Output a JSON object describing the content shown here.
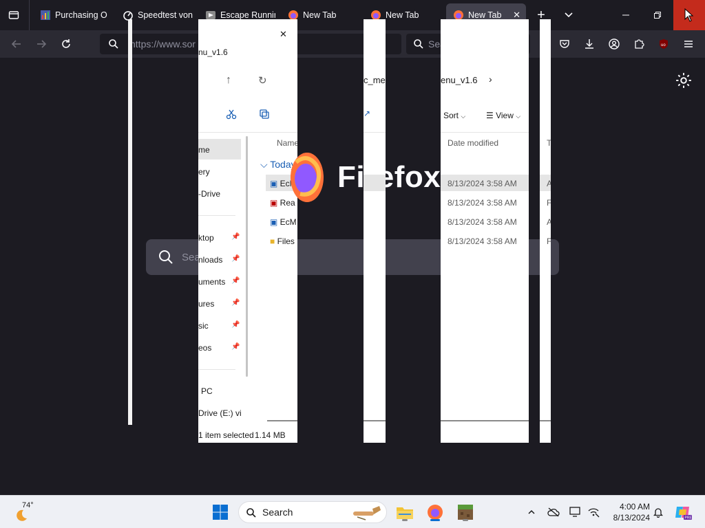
{
  "tabs": [
    {
      "title": "Purchasing O",
      "active": false
    },
    {
      "title": "Speedtest von",
      "active": false
    },
    {
      "title": "Escape Running",
      "active": false
    },
    {
      "title": "New Tab",
      "active": false
    },
    {
      "title": "New Tab",
      "active": false
    },
    {
      "title": "New Tab",
      "active": true
    }
  ],
  "urlbar": {
    "text": "https://www.sor          s.php?easy-cont       ne"
  },
  "searchbar": {
    "placeholder": "Sea"
  },
  "newtab": {
    "brand": "Firefox",
    "search_placeholder": "Sea"
  },
  "explorer": {
    "title_fragment": "nu_v1.6",
    "crumb_fragment_1": "c_men",
    "crumb_fragment_2": "enu_v1.6",
    "sort_label": "Sort",
    "view_label": "View",
    "col_name": "Name",
    "col_date": "Date modified",
    "col_type": "T",
    "group_label": "Today",
    "nav_items": [
      "me",
      "ery",
      "-Drive",
      "ktop",
      "nloads",
      "uments",
      "ures",
      "sic",
      "eos",
      "PC",
      "Drive (E:) vi"
    ],
    "files": [
      {
        "name": "EcM",
        "date": "8/13/2024 3:58 AM",
        "type": "A"
      },
      {
        "name": "Rea",
        "date": "8/13/2024 3:58 AM",
        "type": "F"
      },
      {
        "name": "EcM",
        "date": "8/13/2024 3:58 AM",
        "type": "A"
      },
      {
        "name": "Files",
        "date": "8/13/2024 3:58 AM",
        "type": "F"
      }
    ],
    "status_selected": "item selected",
    "status_size": "1.14 MB"
  },
  "taskbar": {
    "temperature": "74°",
    "search_label": "Search",
    "time": "4:00 AM",
    "date": "8/13/2024"
  },
  "colors": {
    "accent_close": "#c42b1c",
    "chrome_dark": "#1c1b22",
    "toolbar": "#2b2a33"
  }
}
